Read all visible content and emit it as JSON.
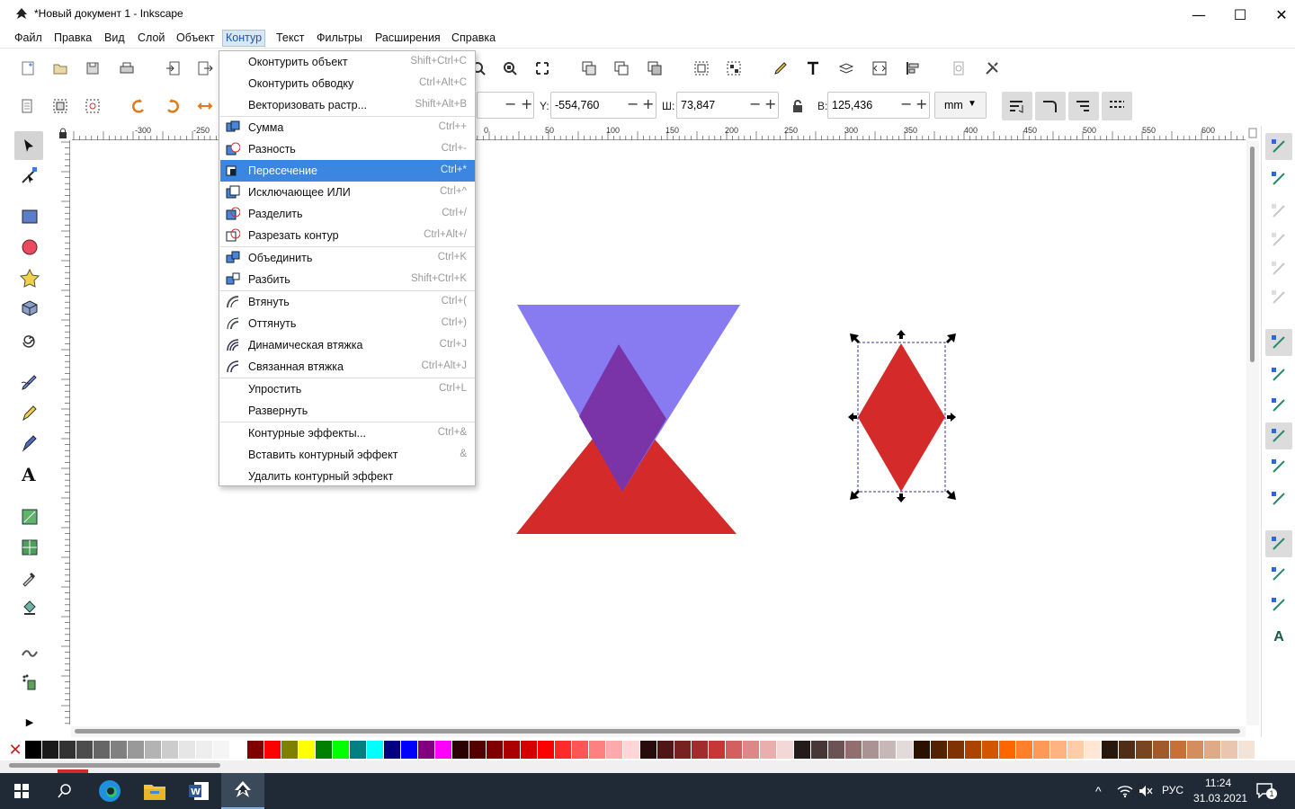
{
  "title": "*Новый документ 1 - Inkscape",
  "menubar": {
    "file": "Файл",
    "edit": "Правка",
    "view": "Вид",
    "layer": "Слой",
    "object": "Объект",
    "path": "Контур",
    "text": "Текст",
    "filters": "Фильтры",
    "extensions": "Расширения",
    "help": "Справка"
  },
  "controls": {
    "y_label": "Y:",
    "y_value": "-554,760",
    "w_label": "Ш:",
    "w_value": "73,847",
    "h_label": "В:",
    "h_value": "125,436",
    "unit": "mm",
    "minus": "−",
    "plus": "+"
  },
  "ruler_ticks": [
    "-300",
    "-250",
    "0",
    "50",
    "100",
    "150",
    "200",
    "250",
    "300",
    "350",
    "400",
    "450",
    "500",
    "550",
    "600"
  ],
  "path_menu": [
    {
      "label": "Оконтурить объект",
      "shortcut": "Shift+Ctrl+C",
      "icon": ""
    },
    {
      "label": "Оконтурить обводку",
      "shortcut": "Ctrl+Alt+C",
      "icon": ""
    },
    {
      "label": "Векторизовать растр...",
      "shortcut": "Shift+Alt+B",
      "icon": ""
    },
    {
      "label": "Сумма",
      "shortcut": "Ctrl++",
      "icon": "union-icon"
    },
    {
      "label": "Разность",
      "shortcut": "Ctrl+-",
      "icon": "difference-icon"
    },
    {
      "label": "Пересечение",
      "shortcut": "Ctrl+*",
      "icon": "intersection-icon"
    },
    {
      "label": "Исключающее ИЛИ",
      "shortcut": "Ctrl+^",
      "icon": "exclusion-icon"
    },
    {
      "label": "Разделить",
      "shortcut": "Ctrl+/",
      "icon": "division-icon"
    },
    {
      "label": "Разрезать контур",
      "shortcut": "Ctrl+Alt+/",
      "icon": "cut-path-icon"
    },
    {
      "label": "Объединить",
      "shortcut": "Ctrl+K",
      "icon": "combine-icon"
    },
    {
      "label": "Разбить",
      "shortcut": "Shift+Ctrl+K",
      "icon": "break-apart-icon"
    },
    {
      "label": "Втянуть",
      "shortcut": "Ctrl+(",
      "icon": "inset-icon"
    },
    {
      "label": "Оттянуть",
      "shortcut": "Ctrl+)",
      "icon": "outset-icon"
    },
    {
      "label": "Динамическая втяжка",
      "shortcut": "Ctrl+J",
      "icon": "dynamic-offset-icon"
    },
    {
      "label": "Связанная втяжка",
      "shortcut": "Ctrl+Alt+J",
      "icon": "linked-offset-icon"
    },
    {
      "label": "Упростить",
      "shortcut": "Ctrl+L",
      "icon": ""
    },
    {
      "label": "Развернуть",
      "shortcut": "",
      "icon": ""
    },
    {
      "label": "Контурные эффекты...",
      "shortcut": "Ctrl+&",
      "icon": ""
    },
    {
      "label": "Вставить контурный эффект",
      "shortcut": "&",
      "icon": ""
    },
    {
      "label": "Удалить контурный эффект",
      "shortcut": "",
      "icon": ""
    }
  ],
  "highlighted_item": "Пересечение",
  "canvas": {
    "shape_colors": {
      "blue": "#7b6cf0",
      "red": "#d42a2a",
      "overlap": "#7a34a8"
    }
  },
  "palette": [
    "#000000",
    "#1a1a1a",
    "#333333",
    "#4d4d4d",
    "#666666",
    "#808080",
    "#999999",
    "#b3b3b3",
    "#cccccc",
    "#e6e6e6",
    "#eeeeee",
    "#f5f5f5",
    "#ffffff",
    "#800000",
    "#ff0000",
    "#808000",
    "#ffff00",
    "#008000",
    "#00ff00",
    "#008080",
    "#00ffff",
    "#000080",
    "#0000ff",
    "#800080",
    "#ff00ff",
    "#2b0000",
    "#550000",
    "#800000",
    "#aa0000",
    "#d40000",
    "#ff0000",
    "#ff2a2a",
    "#ff5555",
    "#ff8080",
    "#ffaaaa",
    "#ffd5d5",
    "#280b0b",
    "#501616",
    "#782121",
    "#a02c2c",
    "#c83737",
    "#d35f5f",
    "#de8787",
    "#e9afaf",
    "#f4d7d7",
    "#241c1c",
    "#483737",
    "#6c5353",
    "#916f6f",
    "#ac9393",
    "#c8b7b7",
    "#e3dbdb",
    "#2b1100",
    "#552200",
    "#803300",
    "#aa4400",
    "#d45500",
    "#ff6600",
    "#ff7f2a",
    "#ff9955",
    "#ffb380",
    "#ffccaa",
    "#ffe6d5",
    "#28170b",
    "#502d16",
    "#784421",
    "#a05a2c",
    "#c87137",
    "#d38d5f",
    "#deaa87",
    "#e9c6af",
    "#f4e3d7"
  ],
  "taskbar": {
    "lang": "РУС",
    "time": "11:24",
    "date": "31.03.2021",
    "notif": "1"
  }
}
